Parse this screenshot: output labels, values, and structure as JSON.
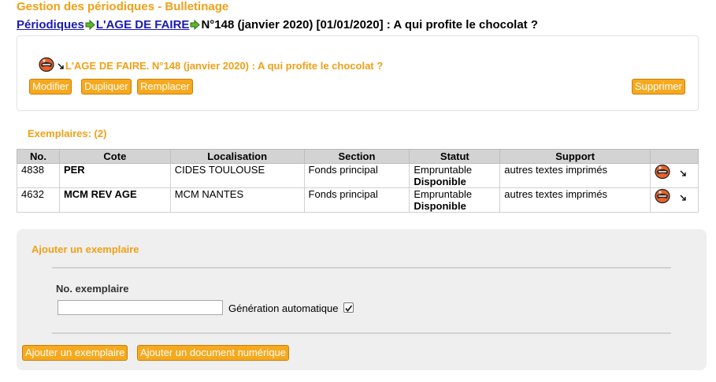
{
  "page": {
    "title": "Gestion des périodiques - Bulletinage"
  },
  "breadcrumb": {
    "link1": "Périodiques",
    "link2": "L'AGE DE FAIRE",
    "current": "N°148 (janvier 2020) [01/01/2020] : A qui profite le chocolat ?"
  },
  "notice": {
    "title": "L'AGE DE FAIRE. N°148 (janvier 2020) : A qui profite le chocolat ?",
    "buttons": {
      "modifier": "Modifier",
      "dupliquer": "Dupliquer",
      "remplacer": "Remplacer",
      "supprimer": "Supprimer"
    }
  },
  "exemplaires": {
    "label": "Exemplaires: (2)",
    "columns": [
      "No.",
      "Cote",
      "Localisation",
      "Section",
      "Statut",
      "Support",
      ""
    ],
    "rows": [
      {
        "no": "4838",
        "cote": "PER",
        "localisation": "CIDES TOULOUSE",
        "section": "Fonds principal",
        "statut": "Empruntable",
        "dispo": "Disponible",
        "support": "autres textes imprimés"
      },
      {
        "no": "4632",
        "cote": "MCM REV AGE",
        "localisation": "MCM NANTES",
        "section": "Fonds principal",
        "statut": "Empruntable",
        "dispo": "Disponible",
        "support": "autres textes imprimés"
      }
    ]
  },
  "add_form": {
    "title": "Ajouter un exemplaire",
    "field_label": "No. exemplaire",
    "field_value": "",
    "auto_label": "Génération automatique",
    "auto_checked": true,
    "btn_add": "Ajouter un exemplaire",
    "btn_add_doc": "Ajouter un document numérique"
  },
  "colors": {
    "accent": "#f0a016",
    "button": "#f7a91e",
    "link": "#1a1ab4"
  }
}
